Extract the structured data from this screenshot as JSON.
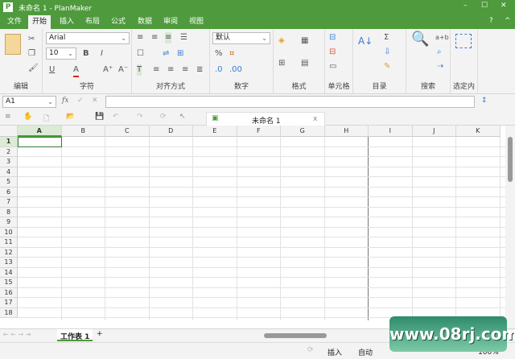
{
  "window": {
    "title": "未命名 1 - PlanMaker",
    "app_icon": "P",
    "controls": [
      "–",
      "☐",
      "✕"
    ],
    "help": "?",
    "collapse": "^"
  },
  "menu": {
    "tabs": [
      "文件",
      "开始",
      "插入",
      "布局",
      "公式",
      "数据",
      "审阅",
      "视图"
    ],
    "active": "开始"
  },
  "ribbon": {
    "groups": [
      "编辑",
      "字符",
      "对齐方式",
      "数字",
      "格式",
      "单元格",
      "目录",
      "搜索",
      "选定内"
    ],
    "font_name": "Arial",
    "font_size": "10",
    "number_format": "默认",
    "bold": "B",
    "italic": "I",
    "underline": "U",
    "font_color_letter": "A",
    "font_color": "#e02020",
    "percent": "%",
    "sum": "Σ",
    "replace": "a+b"
  },
  "formula_bar": {
    "cell_ref": "A1",
    "fx": "fx",
    "value": ""
  },
  "toolbar": {
    "document_tab": "未命名 1",
    "close": "x"
  },
  "grid": {
    "columns": [
      "A",
      "B",
      "C",
      "D",
      "E",
      "F",
      "G",
      "H",
      "I",
      "J",
      "K"
    ],
    "rows": [
      "1",
      "2",
      "3",
      "4",
      "5",
      "6",
      "7",
      "8",
      "9",
      "10",
      "11",
      "12",
      "13",
      "14",
      "15",
      "16",
      "17",
      "18"
    ],
    "active_cell": "A1"
  },
  "sheets": {
    "tabs": [
      "工作表 1"
    ],
    "add": "+"
  },
  "status": {
    "mode": "插入",
    "calc": "自动",
    "zoom": "100%"
  },
  "watermark": "www.08rj.com"
}
